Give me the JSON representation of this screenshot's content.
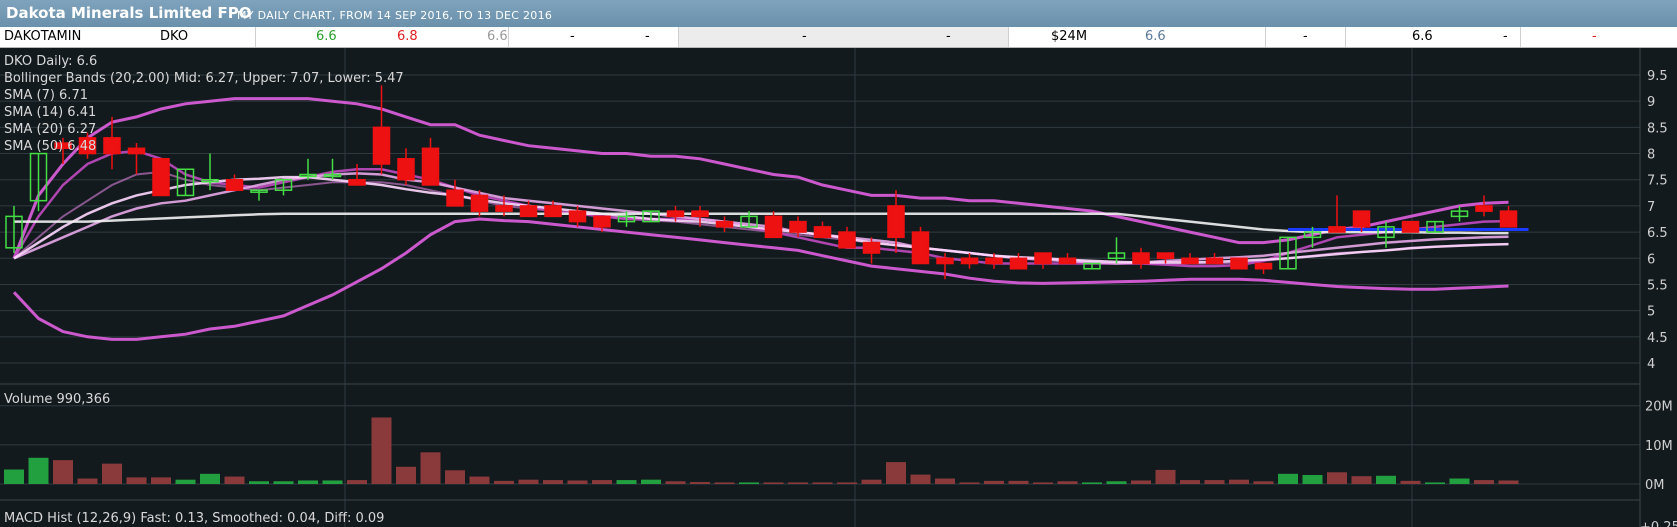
{
  "header": {
    "title": "Dakota Minerals Limited FPO",
    "subtitle": "MY DAILY CHART, FROM 14 SEP 2016, TO 13 DEC 2016"
  },
  "quote": [
    {
      "text": "DAKOTAMIN",
      "color": "#000000"
    },
    {
      "text": "DKO",
      "color": "#000000"
    },
    {
      "text": "6.6",
      "color": "#2aa02a"
    },
    {
      "text": "6.8",
      "color": "#e02020"
    },
    {
      "text": "6.6",
      "color": "#9a9a9a"
    },
    {
      "text": "-",
      "color": "#000000"
    },
    {
      "text": "-",
      "color": "#000000"
    },
    {
      "text": "-",
      "color": "#000000"
    },
    {
      "text": "-",
      "color": "#000000"
    },
    {
      "text": "$24M",
      "color": "#000000"
    },
    {
      "text": "6.6",
      "color": "#5a7a9a"
    },
    {
      "text": "-",
      "color": "#000000"
    },
    {
      "text": "6.6",
      "color": "#000000"
    },
    {
      "text": "-",
      "color": "#000000"
    },
    {
      "text": "-",
      "color": "#e02020"
    }
  ],
  "legend": {
    "daily": "DKO Daily: 6.6",
    "bb": "Bollinger Bands (20,2.00) Mid: 6.27, Upper: 7.07, Lower: 5.47",
    "sma7": "SMA (7) 6.71",
    "sma14": "SMA (14) 6.41",
    "sma20": "SMA (20) 6.27",
    "sma50": "SMA (50) 6.48"
  },
  "volume_label": "Volume 990,366",
  "macd_label": "MACD Hist (12,26,9) Fast: 0.13, Smoothed: 0.04, Diff: 0.09",
  "colors": {
    "up": "#44dd44",
    "down": "#ee1111",
    "bb": "#e060e0",
    "vol_up": "#22a040",
    "vol_down": "#8a3a3a",
    "sma50": "#f2f2f2",
    "grid": "#2e3a40",
    "trend": "#1a3aff"
  },
  "chart_data": {
    "type": "candlestick",
    "price_axis": {
      "ylim": [
        4,
        9.5
      ],
      "ticks": [
        "4",
        "4.5",
        "5",
        "5.5",
        "6",
        "6.5",
        "7",
        "7.5",
        "8",
        "8.5",
        "9",
        "9.5"
      ]
    },
    "volume_axis": {
      "ylim": [
        0,
        23
      ],
      "ticks": [
        "0M",
        "10M",
        "20M"
      ]
    },
    "macd_axis": {
      "ticks": [
        "+0.25"
      ]
    },
    "candles": [
      {
        "o": 6.2,
        "h": 7.0,
        "l": 6.1,
        "c": 6.8
      },
      {
        "o": 7.1,
        "h": 8.0,
        "l": 6.9,
        "c": 8.0
      },
      {
        "o": 8.2,
        "h": 8.3,
        "l": 7.8,
        "c": 8.1
      },
      {
        "o": 8.3,
        "h": 8.4,
        "l": 7.9,
        "c": 8.0
      },
      {
        "o": 8.3,
        "h": 8.7,
        "l": 7.7,
        "c": 8.0
      },
      {
        "o": 8.1,
        "h": 8.2,
        "l": 7.6,
        "c": 8.0
      },
      {
        "o": 7.9,
        "h": 7.9,
        "l": 7.2,
        "c": 7.2
      },
      {
        "o": 7.2,
        "h": 7.7,
        "l": 7.2,
        "c": 7.7
      },
      {
        "o": 7.5,
        "h": 8.0,
        "l": 7.3,
        "c": 7.5
      },
      {
        "o": 7.5,
        "h": 7.6,
        "l": 7.3,
        "c": 7.3
      },
      {
        "o": 7.3,
        "h": 7.3,
        "l": 7.1,
        "c": 7.3
      },
      {
        "o": 7.3,
        "h": 7.5,
        "l": 7.2,
        "c": 7.5
      },
      {
        "o": 7.6,
        "h": 7.9,
        "l": 7.5,
        "c": 7.6
      },
      {
        "o": 7.6,
        "h": 7.9,
        "l": 7.5,
        "c": 7.6
      },
      {
        "o": 7.5,
        "h": 7.8,
        "l": 7.4,
        "c": 7.4
      },
      {
        "o": 8.5,
        "h": 9.3,
        "l": 7.6,
        "c": 7.8
      },
      {
        "o": 7.9,
        "h": 8.1,
        "l": 7.4,
        "c": 7.5
      },
      {
        "o": 8.1,
        "h": 8.3,
        "l": 7.5,
        "c": 7.4
      },
      {
        "o": 7.3,
        "h": 7.5,
        "l": 7.0,
        "c": 7.0
      },
      {
        "o": 7.2,
        "h": 7.3,
        "l": 6.8,
        "c": 6.9
      },
      {
        "o": 7.0,
        "h": 7.2,
        "l": 6.8,
        "c": 6.9
      },
      {
        "o": 7.0,
        "h": 7.1,
        "l": 6.8,
        "c": 6.8
      },
      {
        "o": 7.0,
        "h": 7.1,
        "l": 6.8,
        "c": 6.8
      },
      {
        "o": 6.9,
        "h": 7.0,
        "l": 6.6,
        "c": 6.7
      },
      {
        "o": 6.8,
        "h": 6.8,
        "l": 6.5,
        "c": 6.6
      },
      {
        "o": 6.7,
        "h": 6.9,
        "l": 6.6,
        "c": 6.8
      },
      {
        "o": 6.7,
        "h": 6.9,
        "l": 6.7,
        "c": 6.9
      },
      {
        "o": 6.9,
        "h": 7.0,
        "l": 6.7,
        "c": 6.8
      },
      {
        "o": 6.9,
        "h": 7.0,
        "l": 6.6,
        "c": 6.8
      },
      {
        "o": 6.7,
        "h": 6.8,
        "l": 6.5,
        "c": 6.6
      },
      {
        "o": 6.6,
        "h": 6.9,
        "l": 6.6,
        "c": 6.8
      },
      {
        "o": 6.8,
        "h": 6.9,
        "l": 6.4,
        "c": 6.4
      },
      {
        "o": 6.7,
        "h": 6.8,
        "l": 6.4,
        "c": 6.5
      },
      {
        "o": 6.6,
        "h": 6.7,
        "l": 6.4,
        "c": 6.4
      },
      {
        "o": 6.5,
        "h": 6.6,
        "l": 6.2,
        "c": 6.2
      },
      {
        "o": 6.3,
        "h": 6.4,
        "l": 5.9,
        "c": 6.1
      },
      {
        "o": 7.0,
        "h": 7.3,
        "l": 6.1,
        "c": 6.4
      },
      {
        "o": 6.5,
        "h": 6.6,
        "l": 5.9,
        "c": 5.9
      },
      {
        "o": 6.0,
        "h": 6.1,
        "l": 5.6,
        "c": 5.9
      },
      {
        "o": 6.0,
        "h": 6.1,
        "l": 5.8,
        "c": 5.9
      },
      {
        "o": 6.0,
        "h": 6.1,
        "l": 5.8,
        "c": 5.9
      },
      {
        "o": 6.0,
        "h": 6.1,
        "l": 5.8,
        "c": 5.8
      },
      {
        "o": 6.1,
        "h": 6.1,
        "l": 5.8,
        "c": 5.9
      },
      {
        "o": 6.0,
        "h": 6.1,
        "l": 5.9,
        "c": 5.9
      },
      {
        "o": 5.8,
        "h": 5.9,
        "l": 5.8,
        "c": 5.9
      },
      {
        "o": 6.0,
        "h": 6.4,
        "l": 5.9,
        "c": 6.1
      },
      {
        "o": 6.1,
        "h": 6.2,
        "l": 5.8,
        "c": 5.9
      },
      {
        "o": 6.1,
        "h": 6.1,
        "l": 5.9,
        "c": 6.0
      },
      {
        "o": 6.0,
        "h": 6.1,
        "l": 5.9,
        "c": 5.9
      },
      {
        "o": 6.0,
        "h": 6.1,
        "l": 5.9,
        "c": 5.9
      },
      {
        "o": 6.0,
        "h": 6.0,
        "l": 5.8,
        "c": 5.8
      },
      {
        "o": 5.9,
        "h": 5.9,
        "l": 5.7,
        "c": 5.8
      },
      {
        "o": 5.8,
        "h": 6.4,
        "l": 5.8,
        "c": 6.4
      },
      {
        "o": 6.4,
        "h": 6.6,
        "l": 6.2,
        "c": 6.5
      },
      {
        "o": 6.6,
        "h": 7.2,
        "l": 6.5,
        "c": 6.5
      },
      {
        "o": 6.9,
        "h": 6.9,
        "l": 6.5,
        "c": 6.6
      },
      {
        "o": 6.4,
        "h": 6.7,
        "l": 6.2,
        "c": 6.6
      },
      {
        "o": 6.7,
        "h": 6.7,
        "l": 6.5,
        "c": 6.5
      },
      {
        "o": 6.5,
        "h": 6.7,
        "l": 6.5,
        "c": 6.7
      },
      {
        "o": 6.8,
        "h": 7.0,
        "l": 6.7,
        "c": 6.9
      },
      {
        "o": 7.0,
        "h": 7.2,
        "l": 6.8,
        "c": 6.9
      },
      {
        "o": 6.9,
        "h": 7.0,
        "l": 6.6,
        "c": 6.6
      }
    ],
    "volume": [
      3.7,
      6.7,
      6.1,
      1.4,
      5.2,
      1.7,
      1.7,
      1.1,
      2.6,
      1.9,
      0.7,
      0.7,
      0.9,
      0.9,
      1.0,
      17.0,
      4.4,
      8.1,
      3.5,
      1.9,
      0.8,
      1.1,
      1.0,
      0.9,
      1.0,
      1.0,
      1.1,
      0.7,
      0.5,
      0.4,
      0.4,
      0.4,
      0.4,
      0.4,
      0.4,
      1.1,
      5.6,
      2.4,
      1.4,
      0.4,
      0.8,
      0.8,
      0.4,
      0.7,
      0.4,
      0.7,
      0.9,
      3.6,
      1.0,
      1.0,
      1.1,
      0.7,
      2.6,
      2.3,
      3.0,
      2.0,
      2.1,
      0.8,
      0.4,
      1.4,
      1.0,
      0.9
    ],
    "bollinger": {
      "upper": [
        6.0,
        7.2,
        7.8,
        8.3,
        8.6,
        8.7,
        8.85,
        8.95,
        9.0,
        9.05,
        9.05,
        9.05,
        9.05,
        9.0,
        8.95,
        8.85,
        8.7,
        8.55,
        8.55,
        8.35,
        8.25,
        8.15,
        8.1,
        8.05,
        8.0,
        8.0,
        7.95,
        7.95,
        7.9,
        7.8,
        7.7,
        7.6,
        7.55,
        7.4,
        7.3,
        7.2,
        7.2,
        7.15,
        7.15,
        7.1,
        7.1,
        7.05,
        7.0,
        6.95,
        6.9,
        6.8,
        6.7,
        6.6,
        6.5,
        6.4,
        6.3,
        6.3,
        6.35,
        6.45,
        6.55,
        6.6,
        6.7,
        6.8,
        6.9,
        7.0,
        7.05,
        7.07
      ],
      "mid": [
        6.0,
        6.4,
        6.8,
        7.1,
        7.4,
        7.6,
        7.65,
        7.5,
        7.4,
        7.35,
        7.3,
        7.35,
        7.4,
        7.45,
        7.45,
        7.45,
        7.4,
        7.3,
        7.2,
        7.1,
        7.0,
        6.95,
        6.9,
        6.85,
        6.8,
        6.75,
        6.72,
        6.7,
        6.65,
        6.6,
        6.55,
        6.5,
        6.45,
        6.4,
        6.35,
        6.3,
        6.25,
        6.2,
        6.15,
        6.1,
        6.05,
        6.0,
        5.97,
        5.94,
        5.92,
        5.9,
        5.9,
        5.9,
        5.9,
        5.9,
        5.92,
        5.95,
        6.0,
        6.05,
        6.1,
        6.12,
        6.15,
        6.2,
        6.22,
        6.25,
        6.26,
        6.27
      ],
      "lower": [
        5.35,
        4.85,
        4.6,
        4.5,
        4.45,
        4.45,
        4.5,
        4.55,
        4.65,
        4.7,
        4.8,
        4.9,
        5.1,
        5.3,
        5.55,
        5.8,
        6.1,
        6.45,
        6.7,
        6.75,
        6.72,
        6.7,
        6.65,
        6.6,
        6.55,
        6.5,
        6.45,
        6.4,
        6.35,
        6.3,
        6.25,
        6.2,
        6.15,
        6.05,
        5.95,
        5.85,
        5.8,
        5.75,
        5.7,
        5.62,
        5.56,
        5.53,
        5.52,
        5.53,
        5.54,
        5.55,
        5.56,
        5.58,
        5.6,
        5.6,
        5.6,
        5.58,
        5.54,
        5.5,
        5.46,
        5.44,
        5.42,
        5.41,
        5.41,
        5.43,
        5.45,
        5.47
      ]
    },
    "sma": [
      {
        "name": "SMA (7)",
        "color": "#c04ac0",
        "values": [
          6.0,
          6.8,
          7.4,
          7.8,
          8.0,
          8.05,
          7.9,
          7.6,
          7.45,
          7.4,
          7.35,
          7.45,
          7.55,
          7.65,
          7.7,
          7.7,
          7.6,
          7.5,
          7.35,
          7.2,
          7.1,
          7.0,
          6.9,
          6.85,
          6.8,
          6.75,
          6.75,
          6.75,
          6.75,
          6.7,
          6.6,
          6.5,
          6.4,
          6.3,
          6.2,
          6.2,
          6.15,
          6.1,
          6.0,
          5.95,
          5.9,
          5.9,
          5.9,
          5.9,
          5.9,
          5.9,
          5.9,
          5.88,
          5.85,
          5.85,
          5.87,
          5.95,
          6.1,
          6.25,
          6.4,
          6.45,
          6.5,
          6.55,
          6.6,
          6.65,
          6.7,
          6.71
        ]
      },
      {
        "name": "SMA (14)",
        "color": "#e8a8e8",
        "values": [
          6.0,
          6.2,
          6.4,
          6.6,
          6.8,
          6.95,
          7.05,
          7.1,
          7.2,
          7.3,
          7.4,
          7.5,
          7.55,
          7.6,
          7.62,
          7.6,
          7.5,
          7.45,
          7.35,
          7.25,
          7.15,
          7.1,
          7.05,
          7.0,
          6.95,
          6.9,
          6.85,
          6.8,
          6.75,
          6.7,
          6.65,
          6.6,
          6.5,
          6.45,
          6.4,
          6.35,
          6.3,
          6.2,
          6.15,
          6.1,
          6.05,
          6.0,
          5.97,
          5.95,
          5.92,
          5.9,
          5.92,
          5.95,
          5.97,
          6.0,
          6.02,
          6.05,
          6.1,
          6.15,
          6.2,
          6.25,
          6.3,
          6.33,
          6.36,
          6.38,
          6.4,
          6.41
        ]
      },
      {
        "name": "SMA (20)",
        "color": "#ffd8ff",
        "values": [
          6.0,
          6.3,
          6.6,
          6.85,
          7.05,
          7.2,
          7.3,
          7.4,
          7.45,
          7.5,
          7.52,
          7.55,
          7.55,
          7.5,
          7.45,
          7.4,
          7.32,
          7.25,
          7.2,
          7.12,
          7.05,
          7.0,
          6.95,
          6.9,
          6.85,
          6.8,
          6.75,
          6.72,
          6.7,
          6.65,
          6.6,
          6.55,
          6.5,
          6.45,
          6.38,
          6.3,
          6.25,
          6.2,
          6.15,
          6.1,
          6.05,
          6.02,
          6.0,
          5.97,
          5.95,
          5.93,
          5.92,
          5.92,
          5.92,
          5.93,
          5.95,
          5.97,
          6.0,
          6.04,
          6.08,
          6.12,
          6.15,
          6.19,
          6.22,
          6.24,
          6.26,
          6.27
        ]
      },
      {
        "name": "SMA (50)",
        "color": "#f2f2f2",
        "values": [
          6.7,
          6.7,
          6.7,
          6.7,
          6.72,
          6.74,
          6.76,
          6.78,
          6.8,
          6.82,
          6.84,
          6.85,
          6.85,
          6.85,
          6.85,
          6.85,
          6.85,
          6.85,
          6.85,
          6.85,
          6.85,
          6.85,
          6.85,
          6.85,
          6.85,
          6.85,
          6.85,
          6.85,
          6.85,
          6.85,
          6.85,
          6.85,
          6.85,
          6.85,
          6.85,
          6.85,
          6.85,
          6.85,
          6.85,
          6.85,
          6.85,
          6.85,
          6.85,
          6.85,
          6.85,
          6.85,
          6.8,
          6.75,
          6.7,
          6.65,
          6.6,
          6.55,
          6.52,
          6.5,
          6.5,
          6.5,
          6.5,
          6.5,
          6.49,
          6.49,
          6.48,
          6.48
        ]
      }
    ],
    "trendline": {
      "from": {
        "index": 52,
        "value": 6.55
      },
      "to": {
        "index": 61,
        "value": 6.55
      }
    }
  }
}
